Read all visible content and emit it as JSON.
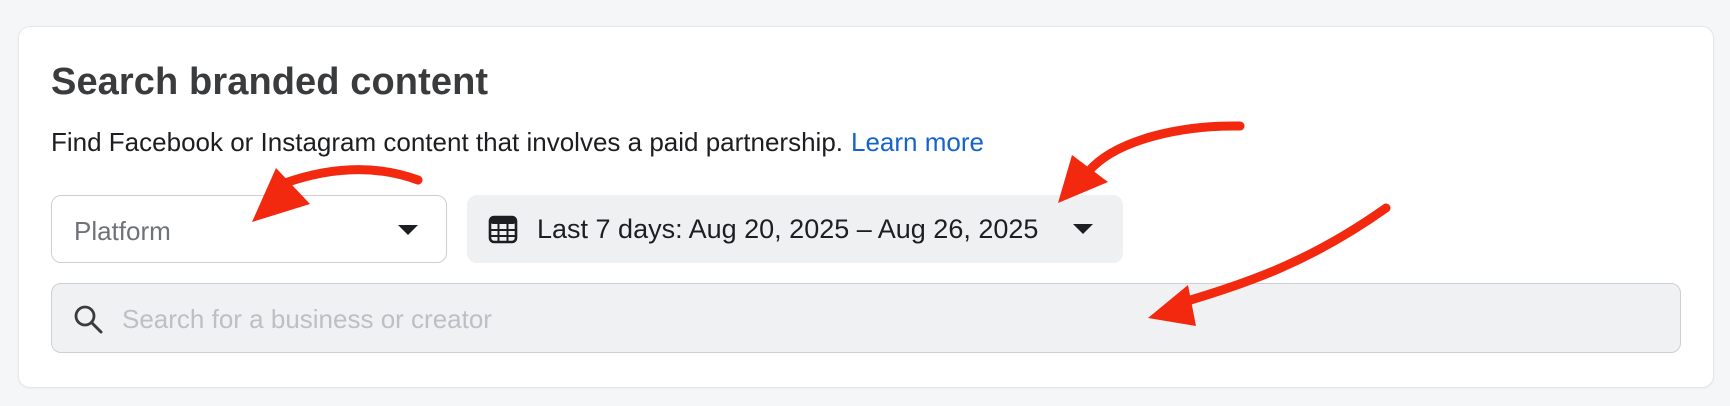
{
  "section": {
    "title": "Search branded content",
    "description": "Find Facebook or Instagram content that involves a paid partnership.",
    "learn_more": "Learn more"
  },
  "platform_select": {
    "placeholder": "Platform",
    "icon": "caret-down-icon"
  },
  "date_range": {
    "label": "Last 7 days: Aug 20, 2025 – Aug 26, 2025",
    "icon": "calendar-icon",
    "dropdown_icon": "caret-down-icon"
  },
  "search": {
    "placeholder": "Search for a business or creator",
    "value": "",
    "icon": "search-icon"
  },
  "annotations": {
    "arrow_color": "#f2280f",
    "count": 3
  },
  "colors": {
    "link": "#1464cc",
    "title": "#3a3b3c",
    "text": "#1c1e21"
  }
}
